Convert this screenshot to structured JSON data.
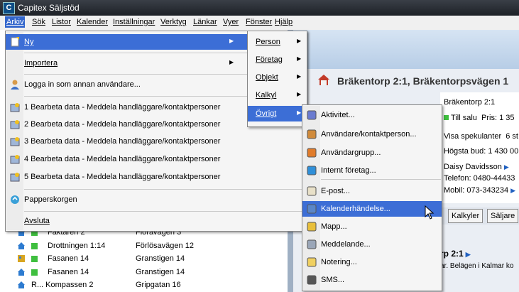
{
  "window": {
    "title": "Capitex Säljstöd",
    "app_icon_letter": "C"
  },
  "menubar": [
    "Arkiv",
    "Sök",
    "Listor",
    "Kalender",
    "Inställningar",
    "Verktyg",
    "Länkar",
    "Vyer",
    "Fönster",
    "Hjälp"
  ],
  "arkiv_menu": {
    "ny": "Ny",
    "importera": "Importera",
    "logga_in": "Logga in som annan användare...",
    "recent": [
      "1 Bearbeta data - Meddela handläggare/kontaktpersoner",
      "2 Bearbeta data - Meddela handläggare/kontaktpersoner",
      "3 Bearbeta data - Meddela handläggare/kontaktpersoner",
      "4 Bearbeta data - Meddela handläggare/kontaktpersoner",
      "5 Bearbeta data - Meddela handläggare/kontaktpersoner"
    ],
    "papperskorgen": "Papperskorgen",
    "avsluta": "Avsluta"
  },
  "ny_menu": [
    "Person",
    "Företag",
    "Objekt",
    "Kalkyl",
    "Övrigt"
  ],
  "ovrigt_menu": [
    {
      "label": "Aktivitet...",
      "icon": "activity-icon"
    },
    {
      "label": "Användare/kontaktperson...",
      "icon": "user-icon"
    },
    {
      "label": "Användargrupp...",
      "icon": "user-group-icon"
    },
    {
      "label": "Internt företag...",
      "icon": "globe-icon"
    },
    {
      "label": "E-post...",
      "icon": "email-icon"
    },
    {
      "label": "Kalenderhändelse...",
      "icon": "calendar-icon"
    },
    {
      "label": "Mapp...",
      "icon": "folder-icon"
    },
    {
      "label": "Meddelande...",
      "icon": "message-icon"
    },
    {
      "label": "Notering...",
      "icon": "note-icon"
    },
    {
      "label": "SMS...",
      "icon": "phone-icon"
    }
  ],
  "property": {
    "title": "Bräkentorp 2:1, Bräkentorpsvägen 1",
    "lines": [
      "Bräkentorp 2:1",
      "Till salu",
      "Pris: 1 35",
      "Visa spekulanter",
      "6 st",
      "Högsta bud: 1 430 00",
      "Daisy Davidsson",
      "Telefon: 0480-44433",
      "Mobil: 073-343234"
    ],
    "tabs": [
      "Kalkyler",
      "Säljare"
    ],
    "lower_title": "rp 2:1",
    "lower_text": "ar. Belägen i Kalmar ko"
  },
  "list_rows": [
    {
      "name": "Faktaren 2",
      "street": "Floravägen 3"
    },
    {
      "name": "Drottningen 1:14",
      "street": "Förlösavägen 12"
    },
    {
      "name": "Fasanen 14",
      "street": "Granstigen 14"
    },
    {
      "name": "Fasanen 14",
      "street": "Granstigen 14"
    },
    {
      "name": "R... Kompassen 2",
      "street": "Gripgatan 16"
    }
  ],
  "colors": {
    "menu_highlight": "#3c6ed6",
    "titlebar": "#1d2127",
    "status_green": "#3fbf3f"
  }
}
